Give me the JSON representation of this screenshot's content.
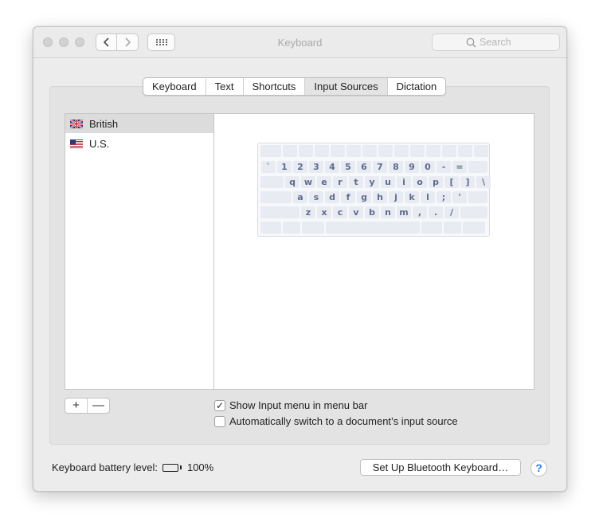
{
  "window": {
    "title": "Keyboard"
  },
  "toolbar": {
    "back_icon": "chevron-left-icon",
    "forward_icon": "chevron-right-icon",
    "grid_icon": "grid-icon"
  },
  "search": {
    "placeholder": "Search"
  },
  "tabs": [
    {
      "label": "Keyboard",
      "selected": false
    },
    {
      "label": "Text",
      "selected": false
    },
    {
      "label": "Shortcuts",
      "selected": false
    },
    {
      "label": "Input Sources",
      "selected": true
    },
    {
      "label": "Dictation",
      "selected": false
    }
  ],
  "input_sources": [
    {
      "label": "British",
      "flag": "uk-flag-icon",
      "selected": true
    },
    {
      "label": "U.S.",
      "flag": "us-flag-icon",
      "selected": false
    }
  ],
  "keyboard_preview": {
    "rows": [
      [
        "`",
        "1",
        "2",
        "3",
        "4",
        "5",
        "6",
        "7",
        "8",
        "9",
        "0",
        "-",
        "="
      ],
      [
        "q",
        "w",
        "e",
        "r",
        "t",
        "y",
        "u",
        "i",
        "o",
        "p",
        "[",
        "]",
        "\\"
      ],
      [
        "a",
        "s",
        "d",
        "f",
        "g",
        "h",
        "j",
        "k",
        "l",
        ";",
        "'"
      ],
      [
        "z",
        "x",
        "c",
        "v",
        "b",
        "n",
        "m",
        ",",
        ".",
        "/"
      ]
    ]
  },
  "list_buttons": {
    "add_label": "+",
    "remove_label": "—"
  },
  "options": {
    "show_input_menu": {
      "label": "Show Input menu in menu bar",
      "checked": true,
      "mark": "✓"
    },
    "auto_switch": {
      "label": "Automatically switch to a document’s input source",
      "checked": false,
      "mark": ""
    }
  },
  "battery": {
    "label": "Keyboard battery level:",
    "value": "100%",
    "level": 1.0
  },
  "bluetooth_button": {
    "label": "Set Up Bluetooth Keyboard…"
  },
  "help": {
    "label": "?"
  }
}
